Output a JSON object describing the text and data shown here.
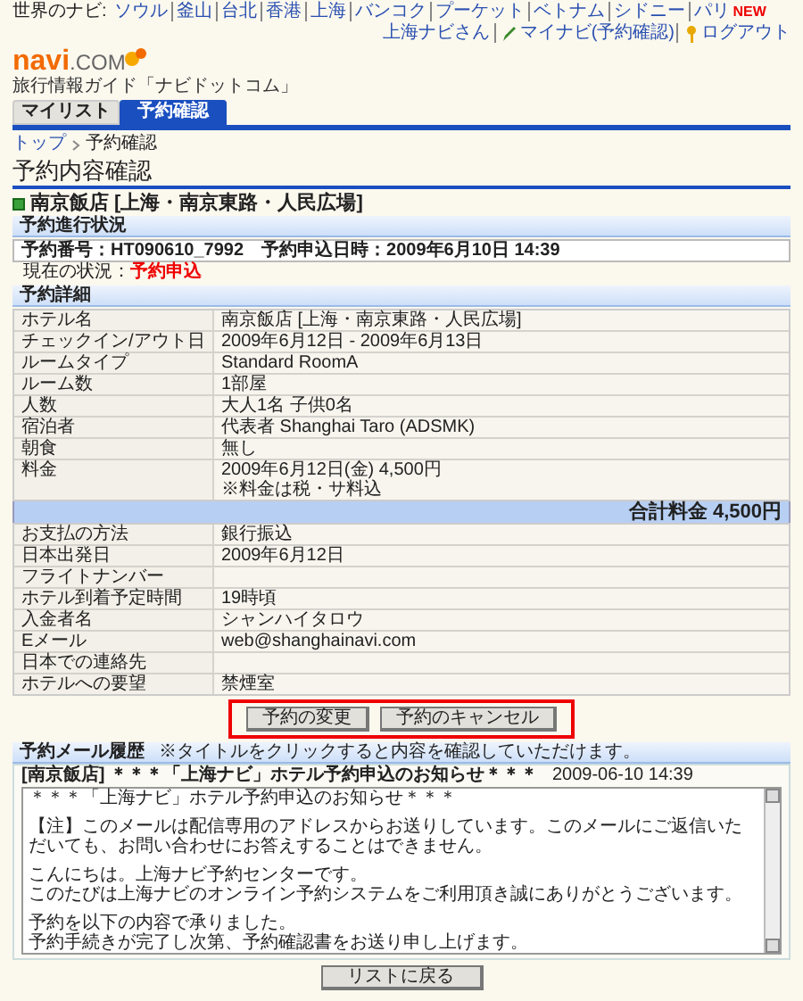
{
  "top_nav": {
    "label": "世界のナビ:",
    "cities": [
      {
        "label": "ソウル"
      },
      {
        "label": "釜山"
      },
      {
        "label": "台北"
      },
      {
        "label": "香港"
      },
      {
        "label": "上海"
      },
      {
        "label": "バンコク"
      },
      {
        "label": "プーケット"
      },
      {
        "label": "ベトナム"
      },
      {
        "label": "シドニー"
      },
      {
        "label": "パリ",
        "badge": "NEW"
      }
    ],
    "user": "上海ナビさん",
    "links": [
      {
        "label": "マイナビ(予約確認)",
        "kind": "pencil"
      },
      {
        "label": "ログアウト",
        "kind": "key"
      }
    ]
  },
  "logo": {
    "name": "navi",
    "suffix": ".COM",
    "tagline": "旅行情報ガイド「ナビドットコム」"
  },
  "tabs": [
    {
      "label": "マイリスト",
      "selected": false
    },
    {
      "label": "予約確認",
      "selected": true
    }
  ],
  "breadcrumb": [
    "トップ",
    "予約確認"
  ],
  "heading": "予約内容確認",
  "hotel_title": "南京飯店 [上海・南京東路・人民広場]",
  "progress": {
    "title": "予約進行状況",
    "number": "予約番号：HT090610_7992",
    "date": "予約申込日時：2009年6月10日 14:39",
    "status_label": "現在の状況：",
    "status": "予約申込"
  },
  "details": {
    "title": "予約詳細",
    "rows": [
      {
        "label": "ホテル名",
        "value": [
          "南京飯店 [上海・南京東路・人民広場]"
        ]
      },
      {
        "label": "チェックイン/アウト日",
        "value": [
          "2009年6月12日 - 2009年6月13日"
        ]
      },
      {
        "label": "ルームタイプ",
        "value": [
          "Standard RoomA"
        ]
      },
      {
        "label": "ルーム数",
        "value": [
          "1部屋"
        ]
      },
      {
        "label": "人数",
        "value": [
          "大人1名 子供0名"
        ]
      },
      {
        "label": "宿泊者",
        "value": [
          "代表者 Shanghai Taro (ADSMK)"
        ]
      },
      {
        "label": "朝食",
        "value": [
          "無し"
        ]
      },
      {
        "label": "料金",
        "value": [
          "2009年6月12日(金) 4,500円",
          "※料金は税・サ料込"
        ]
      }
    ],
    "total": "合計料金 4,500円",
    "rows2": [
      {
        "label": "お支払の方法",
        "value": [
          "銀行振込"
        ]
      },
      {
        "label": "日本出発日",
        "value": [
          "2009年6月12日"
        ]
      },
      {
        "label": "フライトナンバー"
      },
      {
        "label": "ホテル到着予定時間",
        "value": [
          "19時頃"
        ]
      },
      {
        "label": "入金者名",
        "value": [
          "シャンハイタロウ"
        ]
      },
      {
        "label": "Eメール",
        "value": [
          "web@shanghainavi.com"
        ]
      },
      {
        "label": "日本での連絡先"
      },
      {
        "label": "ホテルへの要望",
        "value": [
          "禁煙室"
        ]
      }
    ]
  },
  "buttons": [
    "予約の変更",
    "予約のキャンセル"
  ],
  "mail": {
    "title": "予約メール履歴",
    "note": "※タイトルをクリックすると内容を確認していただけます。",
    "subject": "[南京飯店] ＊＊＊「上海ナビ」ホテル予約申込のお知らせ＊＊＊",
    "date": "2009-06-10 14:39",
    "body": [
      [
        "＊＊＊「上海ナビ」ホテル予約申込のお知らせ＊＊＊"
      ],
      [
        "【注】このメールは配信専用のアドレスからお送りしています。このメールにご返信いただいても、お問い合わせにお答えすることはできません。"
      ],
      [
        "こんにちは。上海ナビ予約センターです。",
        "このたびは上海ナビのオンライン予約システムをご利用頂き誠にありがとうございます。"
      ],
      [
        "予約を以下の内容で承りました。",
        "予約手続きが完了し次第、予約確認書をお送り申し上げます。"
      ]
    ]
  },
  "back_button": "リストに戻る"
}
